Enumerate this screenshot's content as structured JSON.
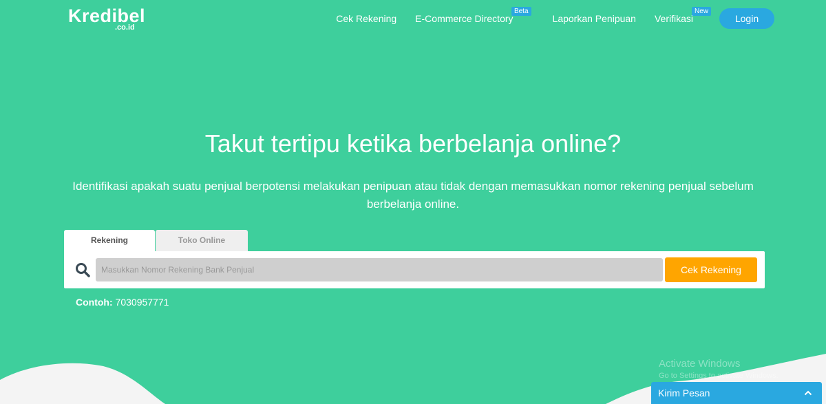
{
  "brand": {
    "logo_text": "Kredibel",
    "logo_suffix": ".co.id"
  },
  "nav": {
    "items": [
      {
        "label": "Cek Rekening",
        "badge": ""
      },
      {
        "label": "E-Commerce Directory",
        "badge": "Beta"
      },
      {
        "label": "Laporkan Penipuan",
        "badge": ""
      },
      {
        "label": "Verifikasi",
        "badge": "New"
      }
    ],
    "login_label": "Login"
  },
  "hero": {
    "title": "Takut tertipu ketika berbelanja online?",
    "subtitle": "Identifikasi apakah suatu penjual berpotensi melakukan penipuan atau tidak dengan memasukkan nomor rekening penjual sebelum berbelanja online."
  },
  "search": {
    "tabs": [
      {
        "label": "Rekening",
        "active": true
      },
      {
        "label": "Toko Online",
        "active": false
      }
    ],
    "placeholder": "Masukkan Nomor Rekening Bank Penjual",
    "value": "",
    "button_label": "Cek Rekening",
    "icon": "search-icon"
  },
  "example": {
    "label": "Contoh:",
    "value": "7030957771"
  },
  "watermark": {
    "title": "Activate Windows",
    "subtitle": "Go to Settings to activate Windows."
  },
  "chat": {
    "label": "Kirim Pesan",
    "icon": "chevron-up-icon"
  },
  "colors": {
    "background": "#3ecf9c",
    "accent_blue": "#2aa8e0",
    "button_orange": "#ffa500"
  }
}
